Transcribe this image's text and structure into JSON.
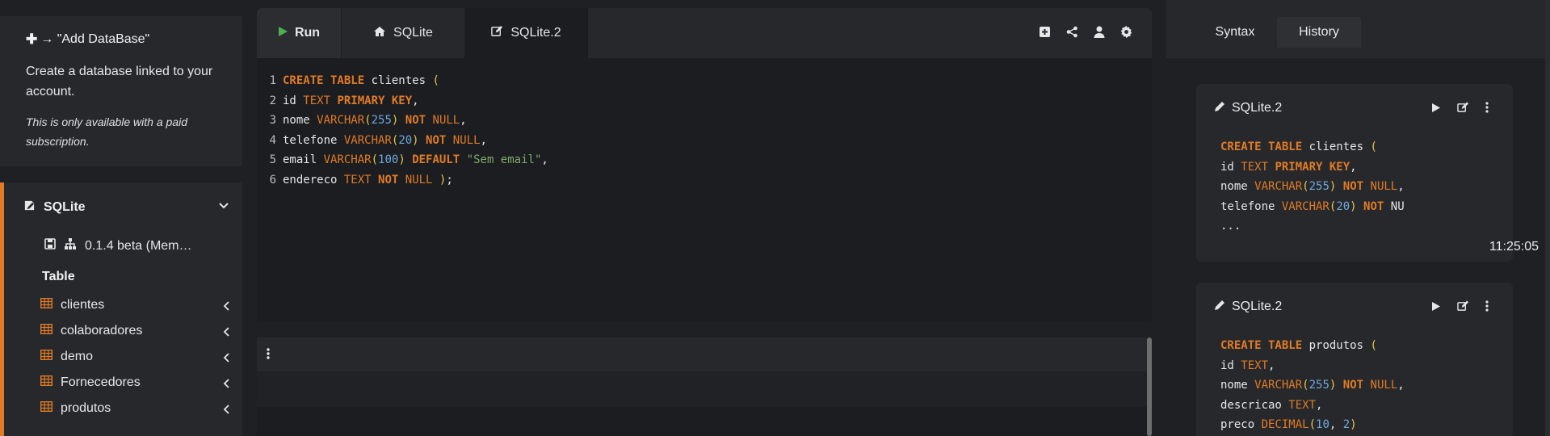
{
  "promo": {
    "title": "→ \"Add DataBase\"",
    "description": "Create a database linked to your account.",
    "note": "This is only available with a paid subscription."
  },
  "database": {
    "name": "SQLite",
    "version": "0.1.4 beta (Mem…",
    "table_heading": "Table",
    "tables": [
      "clientes",
      "colaboradores",
      "demo",
      "Fornecedores",
      "produtos"
    ]
  },
  "editor": {
    "run_label": "Run",
    "tabs": [
      "SQLite",
      "SQLite.2"
    ],
    "code_lines": [
      [
        [
          "kw",
          "CREATE TABLE"
        ],
        [
          "plain",
          " clientes "
        ],
        [
          "par",
          "("
        ]
      ],
      [
        [
          "plain",
          "id "
        ],
        [
          "ty",
          "TEXT"
        ],
        [
          "plain",
          " "
        ],
        [
          "kw",
          "PRIMARY KEY"
        ],
        [
          "plain",
          ","
        ]
      ],
      [
        [
          "plain",
          "nome "
        ],
        [
          "ty",
          "VARCHAR"
        ],
        [
          "par",
          "("
        ],
        [
          "num",
          "255"
        ],
        [
          "par",
          ")"
        ],
        [
          "plain",
          " "
        ],
        [
          "kw",
          "NOT"
        ],
        [
          "plain",
          " "
        ],
        [
          "ty",
          "NULL"
        ],
        [
          "plain",
          ","
        ]
      ],
      [
        [
          "plain",
          "telefone "
        ],
        [
          "ty",
          "VARCHAR"
        ],
        [
          "par",
          "("
        ],
        [
          "num",
          "20"
        ],
        [
          "par",
          ")"
        ],
        [
          "plain",
          " "
        ],
        [
          "kw",
          "NOT"
        ],
        [
          "plain",
          " "
        ],
        [
          "ty",
          "NULL"
        ],
        [
          "plain",
          ","
        ]
      ],
      [
        [
          "plain",
          "email "
        ],
        [
          "ty",
          "VARCHAR"
        ],
        [
          "par",
          "("
        ],
        [
          "num",
          "100"
        ],
        [
          "par",
          ")"
        ],
        [
          "plain",
          " "
        ],
        [
          "kw",
          "DEFAULT"
        ],
        [
          "plain",
          " "
        ],
        [
          "str",
          "\"Sem email\""
        ],
        [
          "plain",
          ","
        ]
      ],
      [
        [
          "plain",
          "endereco "
        ],
        [
          "ty",
          "TEXT"
        ],
        [
          "plain",
          " "
        ],
        [
          "kw",
          "NOT"
        ],
        [
          "plain",
          " "
        ],
        [
          "ty",
          "NULL"
        ],
        [
          "plain",
          " "
        ],
        [
          "par",
          ")"
        ],
        [
          "plain",
          ";"
        ]
      ]
    ]
  },
  "right_panel": {
    "tabs": [
      "Syntax",
      "History"
    ],
    "history": [
      {
        "title": "SQLite.2",
        "time": "11:25:05",
        "lines": [
          [
            [
              "kw",
              "CREATE TABLE"
            ],
            [
              "plain",
              " clientes "
            ],
            [
              "par",
              "("
            ]
          ],
          [
            [
              "plain",
              "id "
            ],
            [
              "ty",
              "TEXT"
            ],
            [
              "plain",
              " "
            ],
            [
              "kw",
              "PRIMARY KEY"
            ],
            [
              "plain",
              ","
            ]
          ],
          [
            [
              "plain",
              "nome "
            ],
            [
              "ty",
              "VARCHAR"
            ],
            [
              "par",
              "("
            ],
            [
              "num",
              "255"
            ],
            [
              "par",
              ")"
            ],
            [
              "plain",
              " "
            ],
            [
              "kw",
              "NOT"
            ],
            [
              "plain",
              " "
            ],
            [
              "ty",
              "NULL"
            ],
            [
              "plain",
              ","
            ]
          ],
          [
            [
              "plain",
              "telefone "
            ],
            [
              "ty",
              "VARCHAR"
            ],
            [
              "par",
              "("
            ],
            [
              "num",
              "20"
            ],
            [
              "par",
              ")"
            ],
            [
              "plain",
              " "
            ],
            [
              "kw",
              "NOT"
            ],
            [
              "plain",
              " NU"
            ]
          ],
          [
            [
              "plain",
              "..."
            ]
          ]
        ]
      },
      {
        "title": "SQLite.2",
        "time": "",
        "lines": [
          [
            [
              "kw",
              "CREATE TABLE"
            ],
            [
              "plain",
              " produtos "
            ],
            [
              "par",
              "("
            ]
          ],
          [
            [
              "plain",
              "id "
            ],
            [
              "ty",
              "TEXT"
            ],
            [
              "plain",
              ","
            ]
          ],
          [
            [
              "plain",
              "nome "
            ],
            [
              "ty",
              "VARCHAR"
            ],
            [
              "par",
              "("
            ],
            [
              "num",
              "255"
            ],
            [
              "par",
              ")"
            ],
            [
              "plain",
              " "
            ],
            [
              "kw",
              "NOT"
            ],
            [
              "plain",
              " "
            ],
            [
              "ty",
              "NULL"
            ],
            [
              "plain",
              ","
            ]
          ],
          [
            [
              "plain",
              "descricao "
            ],
            [
              "ty",
              "TEXT"
            ],
            [
              "plain",
              ","
            ]
          ],
          [
            [
              "plain",
              "preco "
            ],
            [
              "ty",
              "DECIMAL"
            ],
            [
              "par",
              "("
            ],
            [
              "num",
              "10"
            ],
            [
              "plain",
              ", "
            ],
            [
              "num",
              "2"
            ],
            [
              "par",
              ")"
            ]
          ]
        ]
      }
    ]
  },
  "colors": {
    "accent": "#e07b26",
    "run_green": "#4caf50",
    "background": "#1e2023",
    "panel": "#26282c"
  }
}
